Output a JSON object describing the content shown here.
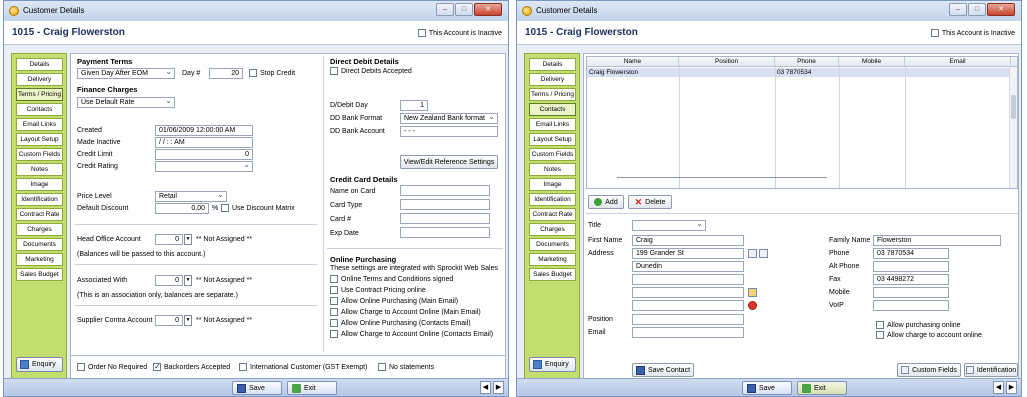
{
  "common": {
    "window_title": "Customer Details",
    "page_title": "1015 - Craig Flowerston",
    "inactive_label": "This Account is Inactive",
    "nav_items": [
      "Details",
      "Delivery",
      "Terms / Pricing",
      "Contacts",
      "Email Links",
      "Layout Setup",
      "Custom Fields",
      "Notes",
      "Image",
      "Identification",
      "Contract Rate",
      "Charges",
      "Documents",
      "Marketing",
      "Sales Budget"
    ],
    "enquiry_label": "Enquiry",
    "save_label": "Save",
    "exit_label": "Exit",
    "win_minimize_icon": "minimize-icon",
    "win_maximize_icon": "maximize-icon",
    "win_close_icon": "close-icon",
    "colors": {
      "sidebar": "#c1de6f",
      "title_text": "#1a2f5c",
      "footer": "#b5c8e6"
    }
  },
  "left": {
    "active_nav": "Terms / Pricing",
    "payment_terms": {
      "heading": "Payment Terms",
      "value": "Given Day After EOM",
      "day_label": "Day #",
      "day_value": "20",
      "stop_credit": "Stop Credit"
    },
    "finance_charges": {
      "heading": "Finance Charges",
      "value": "Use Default Rate"
    },
    "created": {
      "label": "Created",
      "value": "01/06/2009 12:00:00 AM"
    },
    "made_inactive": {
      "label": "Made Inactive",
      "value": " / /      : : AM"
    },
    "credit_limit": {
      "label": "Credit Limit",
      "value": "0"
    },
    "credit_rating": {
      "label": "Credit Rating",
      "value": ""
    },
    "price_level": {
      "label": "Price Level",
      "value": "Retail"
    },
    "default_discount": {
      "label": "Default Discount",
      "value": "0.00",
      "unit": "%",
      "matrix": "Use Discount Matrix"
    },
    "head_office": {
      "label": "Head Office Account",
      "value": "0",
      "status": "** Not Assigned **",
      "note": "(Balances will be passed to this account.)"
    },
    "associated": {
      "label": "Associated With",
      "value": "0",
      "status": "** Not Assigned **",
      "note": "(This is an association only, balances are separate.)"
    },
    "supplier_contra": {
      "label": "Supplier Contra Account",
      "value": "0",
      "status": "** Not Assigned **"
    },
    "direct_debit": {
      "heading": "Direct Debit Details",
      "accepted": "Direct Debits Accepted",
      "day_label": "D/Debit Day",
      "day_value": "1",
      "format_label": "DD Bank Format",
      "format_value": "New Zealand Bank format",
      "account_label": "DD Bank Account",
      "account_value": " -   -    -",
      "ref_button": "View/Edit Reference Settings"
    },
    "credit_card": {
      "heading": "Credit Card Details",
      "name_label": "Name on Card",
      "type_label": "Card Type",
      "number_label": "Card #",
      "expiry_label": "Exp Date"
    },
    "online": {
      "heading": "Online Purchasing",
      "note": "These settings are integrated with Sprockit Web Sales",
      "options": [
        "Online Terms and Conditions signed",
        "Use Contract Pricing online",
        "Allow Online Purchasing (Main Email)",
        "Allow Charge to Account Online (Main Email)",
        "Allow Online Purchasing (Contacts Email)",
        "Allow Charge to Account Online (Contacts Email)"
      ]
    },
    "bottom_options": [
      {
        "label": "Order No Required",
        "checked": false
      },
      {
        "label": "Backorders Accepted",
        "checked": true
      },
      {
        "label": "International Customer (GST Exempt)",
        "checked": false
      },
      {
        "label": "No statements",
        "checked": false
      }
    ]
  },
  "right": {
    "active_nav": "Contacts",
    "grid": {
      "columns": [
        "Name",
        "Position",
        "Phone",
        "Mobile",
        "Email"
      ],
      "rows": [
        {
          "name": "Craig Flowerston",
          "position": "",
          "phone": "03 7870534",
          "mobile": "",
          "email": ""
        }
      ]
    },
    "add_label": "Add",
    "delete_label": "Delete",
    "form": {
      "title_label": "Title",
      "title_value": "",
      "first_name_label": "First Name",
      "first_name_value": "Craig",
      "address_label": "Address",
      "address_lines": [
        "199 Grander St",
        "Dunedin",
        "",
        "",
        ""
      ],
      "position_label": "Position",
      "position_value": "",
      "email_label": "Email",
      "email_value": "",
      "family_name_label": "Family Name",
      "family_name_value": "Flowerston",
      "phone_label": "Phone",
      "phone_value": "03 7870534",
      "alt_phone_label": "Alt Phone",
      "alt_phone_value": "",
      "fax_label": "Fax",
      "fax_value": "03 4498272",
      "mobile_label": "Mobile",
      "mobile_value": "",
      "voip_label": "VoIP",
      "voip_value": "",
      "allow_purchasing": "Allow purchasing online",
      "allow_charge": "Allow charge to account online"
    },
    "save_contact_label": "Save Contact",
    "custom_fields_label": "Custom Fields",
    "identification_label": "Identification"
  }
}
